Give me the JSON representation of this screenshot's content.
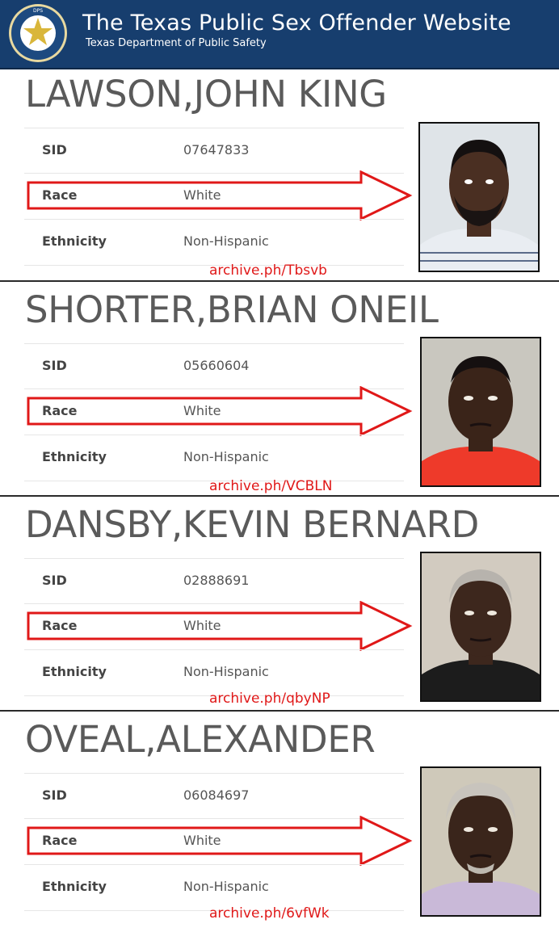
{
  "header": {
    "title": "The Texas Public Sex Offender Website",
    "subtitle": "Texas Department of Public Safety",
    "seal_text": "DEPARTMENT OF PUBLIC SAFETY",
    "seal_letters": [
      "T",
      "E",
      "X",
      "A",
      "S"
    ]
  },
  "field_labels": {
    "sid": "SID",
    "race": "Race",
    "ethnicity": "Ethnicity"
  },
  "records": [
    {
      "name": "LAWSON,JOHN KING",
      "sid": "07647833",
      "race": "White",
      "ethnicity": "Non-Hispanic",
      "archive": "archive.ph/Tbsvb",
      "photo_bg": "#dfe4e8",
      "shirt_color": "#e9edf2"
    },
    {
      "name": "SHORTER,BRIAN ONEIL",
      "sid": "05660604",
      "race": "White",
      "ethnicity": "Non-Hispanic",
      "archive": "archive.ph/VCBLN",
      "photo_bg": "#c9c7bf",
      "shirt_color": "#ee3a2a"
    },
    {
      "name": "DANSBY,KEVIN BERNARD",
      "sid": "02888691",
      "race": "White",
      "ethnicity": "Non-Hispanic",
      "archive": "archive.ph/qbyNP",
      "photo_bg": "#d2cbc0",
      "shirt_color": "#1c1c1c"
    },
    {
      "name": "OVEAL,ALEXANDER",
      "sid": "06084697",
      "race": "White",
      "ethnicity": "Non-Hispanic",
      "archive": "archive.ph/6vfWk",
      "photo_bg": "#cfc9ba",
      "shirt_color": "#c9b9d8"
    }
  ],
  "colors": {
    "header_bg": "#173e6e",
    "arrow": "#e01818",
    "archive_text": "#e01818",
    "skin": "#4a2f22"
  }
}
